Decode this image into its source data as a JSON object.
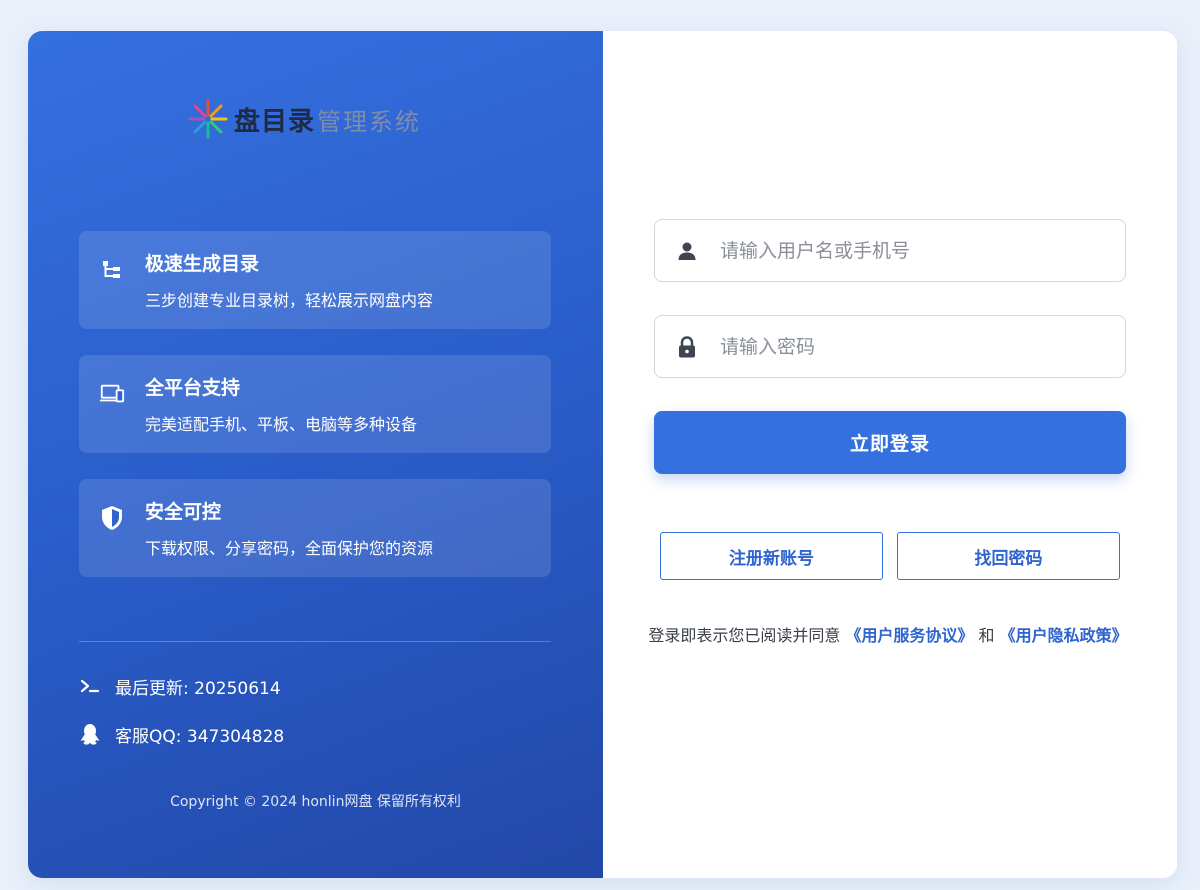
{
  "brand": {
    "title": "盘目录",
    "subtitle": "管理系统"
  },
  "features": [
    {
      "icon": "tree-structure-icon",
      "title": "极速生成目录",
      "desc": "三步创建专业目录树，轻松展示网盘内容"
    },
    {
      "icon": "devices-icon",
      "title": "全平台支持",
      "desc": "完美适配手机、平板、电脑等多种设备"
    },
    {
      "icon": "shield-icon",
      "title": "安全可控",
      "desc": "下载权限、分享密码，全面保护您的资源"
    }
  ],
  "info": {
    "update_label": "最后更新: 20250614",
    "support_label": "客服QQ: 347304828"
  },
  "copyright": "Copyright © 2024 honlin网盘 保留所有权利",
  "form": {
    "username_placeholder": "请输入用户名或手机号",
    "username_value": "",
    "password_placeholder": "请输入密码",
    "password_value": "",
    "login_label": "立即登录",
    "register_label": "注册新账号",
    "recover_label": "找回密码"
  },
  "agreement": {
    "prefix": "登录即表示您已阅读并同意 ",
    "terms_link": "《用户服务协议》",
    "and": " 和 ",
    "privacy_link": "《用户隐私政策》"
  },
  "colors": {
    "accent": "#3571de",
    "panel_start": "#3570df",
    "panel_end": "#2248a8",
    "background": "#e9f0fa"
  }
}
